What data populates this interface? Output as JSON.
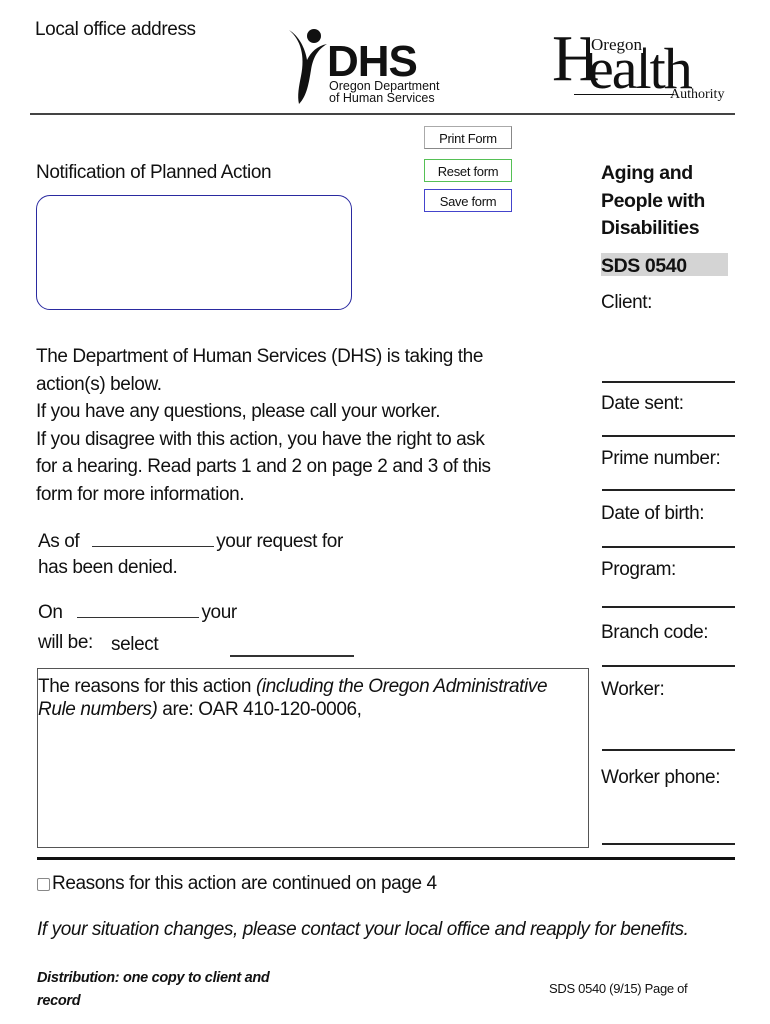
{
  "header": {
    "local_office_label": "Local office address",
    "dhs_logo": {
      "icon": "person-figure-icon",
      "word": "DHS",
      "line1": "Oregon Department",
      "line2": "of Human Services"
    },
    "oha_logo": {
      "big_letter": "H",
      "letters": "ealth",
      "small_top": "Oregon",
      "small_bottom": "Authority"
    }
  },
  "toolbar": {
    "print_label": "Print Form",
    "reset_label": "Reset form",
    "save_label": "Save form",
    "colors": {
      "print_border": "#aaaaaa",
      "reset_border": "#55c055",
      "save_border": "#4444cc"
    }
  },
  "form": {
    "title": "Notification of Planned Action",
    "notice_box_value": "",
    "intro": [
      "The Department of Human Services (DHS) is taking the",
      "action(s) below.",
      "If you have any questions, please call your worker.",
      "If you disagree with this action, you have the right to ask",
      "for a hearing. Read parts 1 and 2 on page 2 and 3 of this",
      "form for more information."
    ],
    "denial": {
      "as_of": "As of",
      "your_request_for": "your request for",
      "has_been_denied": "has been denied.",
      "date_value": "",
      "request_value": ""
    },
    "change": {
      "on": "On",
      "your": "your",
      "will_be": "will be:",
      "select_value": "select",
      "date_value": "",
      "item_value": "",
      "amount_value": ""
    },
    "reasons": {
      "prefix": "The reasons for this action ",
      "italic": "(including the Oregon Administrative Rule numbers)",
      "suffix": " are: OAR 410-120-0006,"
    },
    "continued_checkbox": {
      "label": "Reasons for this action are continued on page 4",
      "checked": false
    },
    "situation_note": "If your situation changes, please contact your local office and reapply for benefits."
  },
  "sidebar": {
    "heading_lines": [
      "Aging and",
      "People with",
      "Disabilities"
    ],
    "form_code": "SDS 0540",
    "form_code_bg": "#d4d4d4",
    "fields": [
      {
        "label": "Client:",
        "value": ""
      },
      {
        "label": "Date sent:",
        "value": ""
      },
      {
        "label": "Prime number:",
        "value": ""
      },
      {
        "label": "Date of birth:",
        "value": ""
      },
      {
        "label": "Program:",
        "value": ""
      },
      {
        "label": "Branch code:",
        "value": ""
      },
      {
        "label": "Worker:",
        "value": ""
      },
      {
        "label": "Worker phone:",
        "value": ""
      }
    ]
  },
  "footer": {
    "distribution_line1": "Distribution: one copy to client and",
    "distribution_line2": "record",
    "form_id": "SDS 0540 (9/15) Page  of"
  }
}
